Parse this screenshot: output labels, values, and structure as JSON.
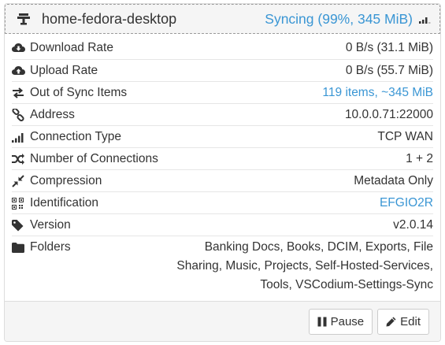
{
  "device": {
    "name": "home-fedora-desktop",
    "status": "Syncing (99%, 345 MiB)",
    "sync_progress_percent": 99
  },
  "rows": [
    {
      "icon": "cloud-download-icon",
      "label": "Download Rate",
      "value": "0 B/s (31.1 MiB)"
    },
    {
      "icon": "cloud-upload-icon",
      "label": "Upload Rate",
      "value": "0 B/s (55.7 MiB)"
    },
    {
      "icon": "exchange-icon",
      "label": "Out of Sync Items",
      "value": "119 items, ~345 MiB"
    },
    {
      "icon": "link-icon",
      "label": "Address",
      "value": "10.0.0.71:22000"
    },
    {
      "icon": "signal-icon",
      "label": "Connection Type",
      "value": "TCP WAN"
    },
    {
      "icon": "random-icon",
      "label": "Number of Connections",
      "value": "1 + 2"
    },
    {
      "icon": "compress-icon",
      "label": "Compression",
      "value": "Metadata Only"
    },
    {
      "icon": "qrcode-icon",
      "label": "Identification",
      "value": "EFGIO2R"
    },
    {
      "icon": "tag-icon",
      "label": "Version",
      "value": "v2.0.14"
    },
    {
      "icon": "folder-icon",
      "label": "Folders",
      "value": "Banking Docs, Books, DCIM, Exports, File Sharing, Music, Projects, Self-Hosted-Services, Tools, VSCodium-Settings-Sync"
    }
  ],
  "buttons": {
    "pause": "Pause",
    "edit": "Edit"
  },
  "colors": {
    "accent": "#3a96d4",
    "text": "#333333",
    "heading_bg": "#f5f5f5"
  }
}
